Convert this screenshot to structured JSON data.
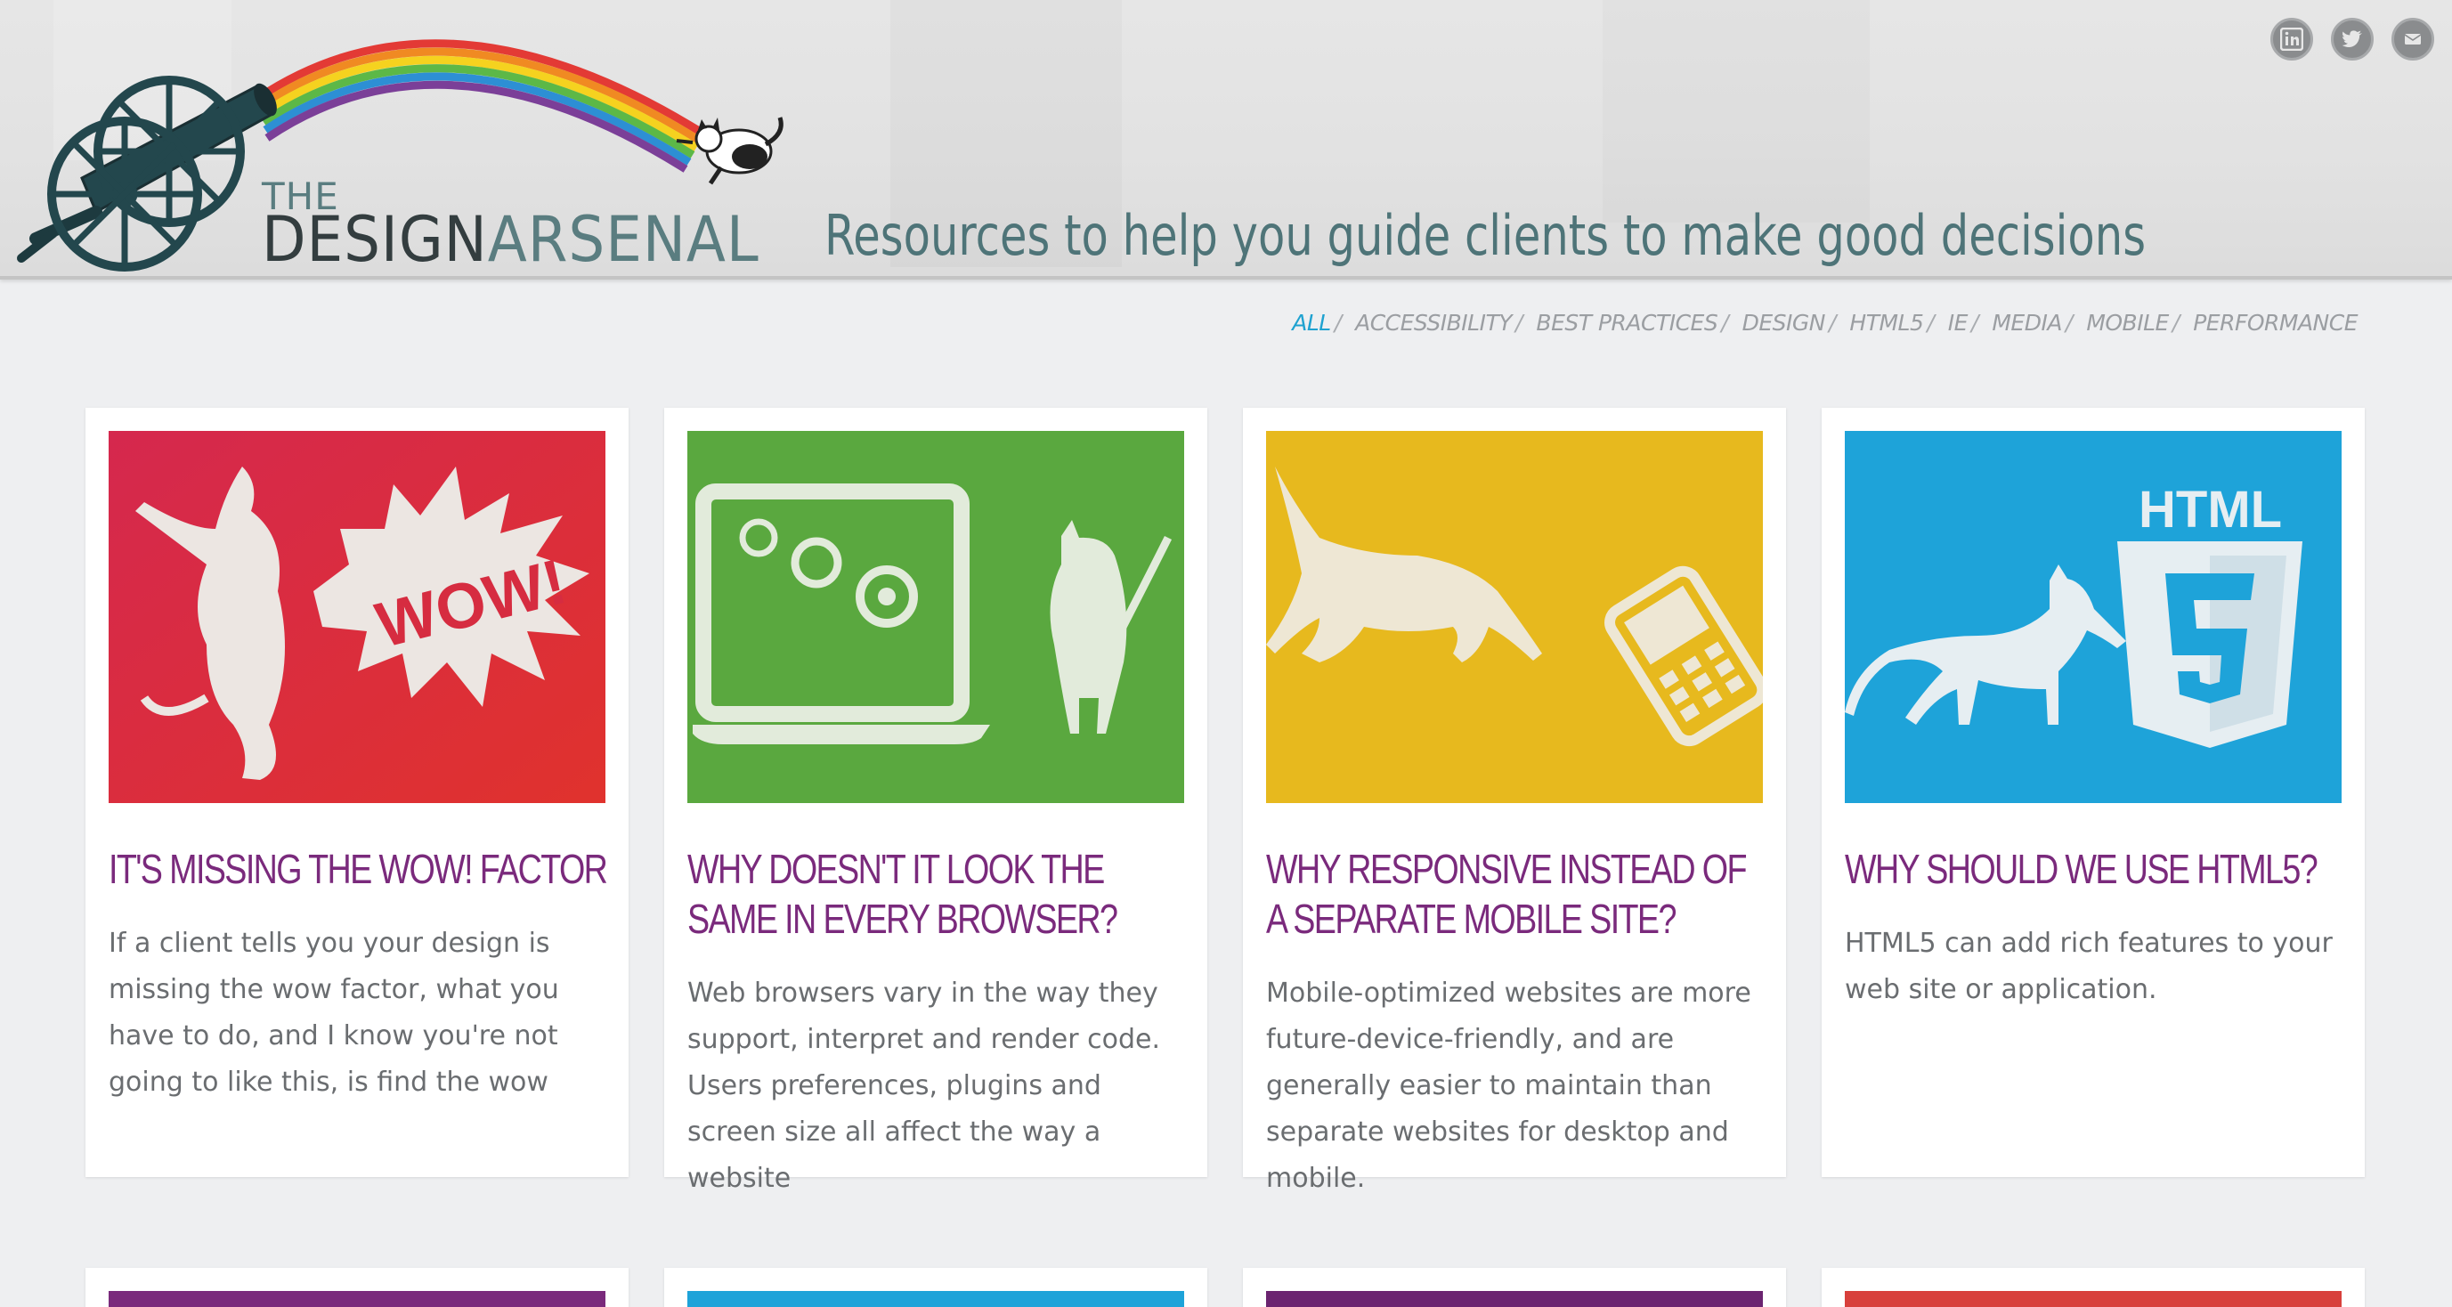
{
  "header": {
    "logo_the": "THE",
    "logo_design": "DESIGN",
    "logo_arsenal": "ARSENAL",
    "tagline": "Resources to help you guide clients to make good decisions",
    "social": [
      {
        "name": "linkedin",
        "icon": "linkedin-icon"
      },
      {
        "name": "twitter",
        "icon": "twitter-icon"
      },
      {
        "name": "email",
        "icon": "email-icon"
      }
    ]
  },
  "filters": {
    "items": [
      "ALL",
      "ACCESSIBILITY",
      "BEST PRACTICES",
      "DESIGN",
      "HTML5",
      "IE",
      "MEDIA",
      "MOBILE",
      "PERFORMANCE"
    ],
    "active": "ALL",
    "separator": "/"
  },
  "cards": [
    {
      "title": "IT'S MISSING THE WOW! FACTOR",
      "excerpt": "If a client tells you your design is missing the wow factor, what you have to do, and I know you're not going to like this, is find the wow",
      "image_color": "#d72b45",
      "image_text": "WOW!"
    },
    {
      "title": "WHY DOESN'T IT LOOK THE SAME IN EVERY BROWSER?",
      "excerpt": "Web browsers vary in the way they support, interpret and render code. Users preferences, plugins and screen size all affect the way a website",
      "image_color": "#5aa83f",
      "image_text": ""
    },
    {
      "title": "WHY RESPONSIVE INSTEAD OF A SEPARATE MOBILE SITE?",
      "excerpt": "Mobile-optimized websites are more future-device-friendly, and are generally easier to maintain than separate websites for desktop and mobile.",
      "image_color": "#e7b91e",
      "image_text": ""
    },
    {
      "title": "WHY SHOULD WE USE HTML5?",
      "excerpt": "HTML5 can add rich features to your web site or application.",
      "image_color": "#1ea3d9",
      "image_text": "HTML"
    }
  ],
  "next_row_colors": [
    "#7a2a7c",
    "#1ea3d9",
    "#6b2470",
    "#d8403c"
  ],
  "colors": {
    "accent": "#1fa2d0",
    "title": "#7a2a7c",
    "tagline": "#4e7478"
  }
}
